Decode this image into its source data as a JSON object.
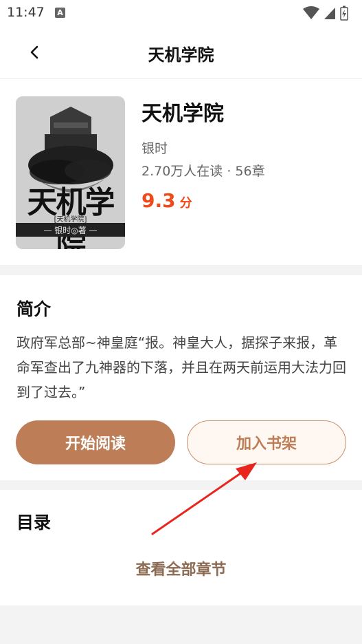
{
  "status": {
    "time": "11:47",
    "a_label": "A"
  },
  "header": {
    "title": "天机学院"
  },
  "book": {
    "title": "天机学院",
    "author": "银时",
    "readers": "2.70万人在读 · 56章",
    "score": "9.3",
    "score_unit": "分",
    "cover": {
      "title": "天机学院",
      "subtitle": "[天机学院]",
      "band": "— 银时◎著 —"
    }
  },
  "intro": {
    "heading": "简介",
    "text": "政府军总部~神皇庭“报。神皇大人，据探子来报，革命军查出了九神器的下落，并且在两天前运用大法力回到了过去。”"
  },
  "buttons": {
    "read": "开始阅读",
    "shelf": "加入书架"
  },
  "toc": {
    "heading": "目录",
    "link": "查看全部章节"
  },
  "colors": {
    "accent": "#bd7d56",
    "score": "#f04a1c",
    "arrow": "#e8261e"
  }
}
